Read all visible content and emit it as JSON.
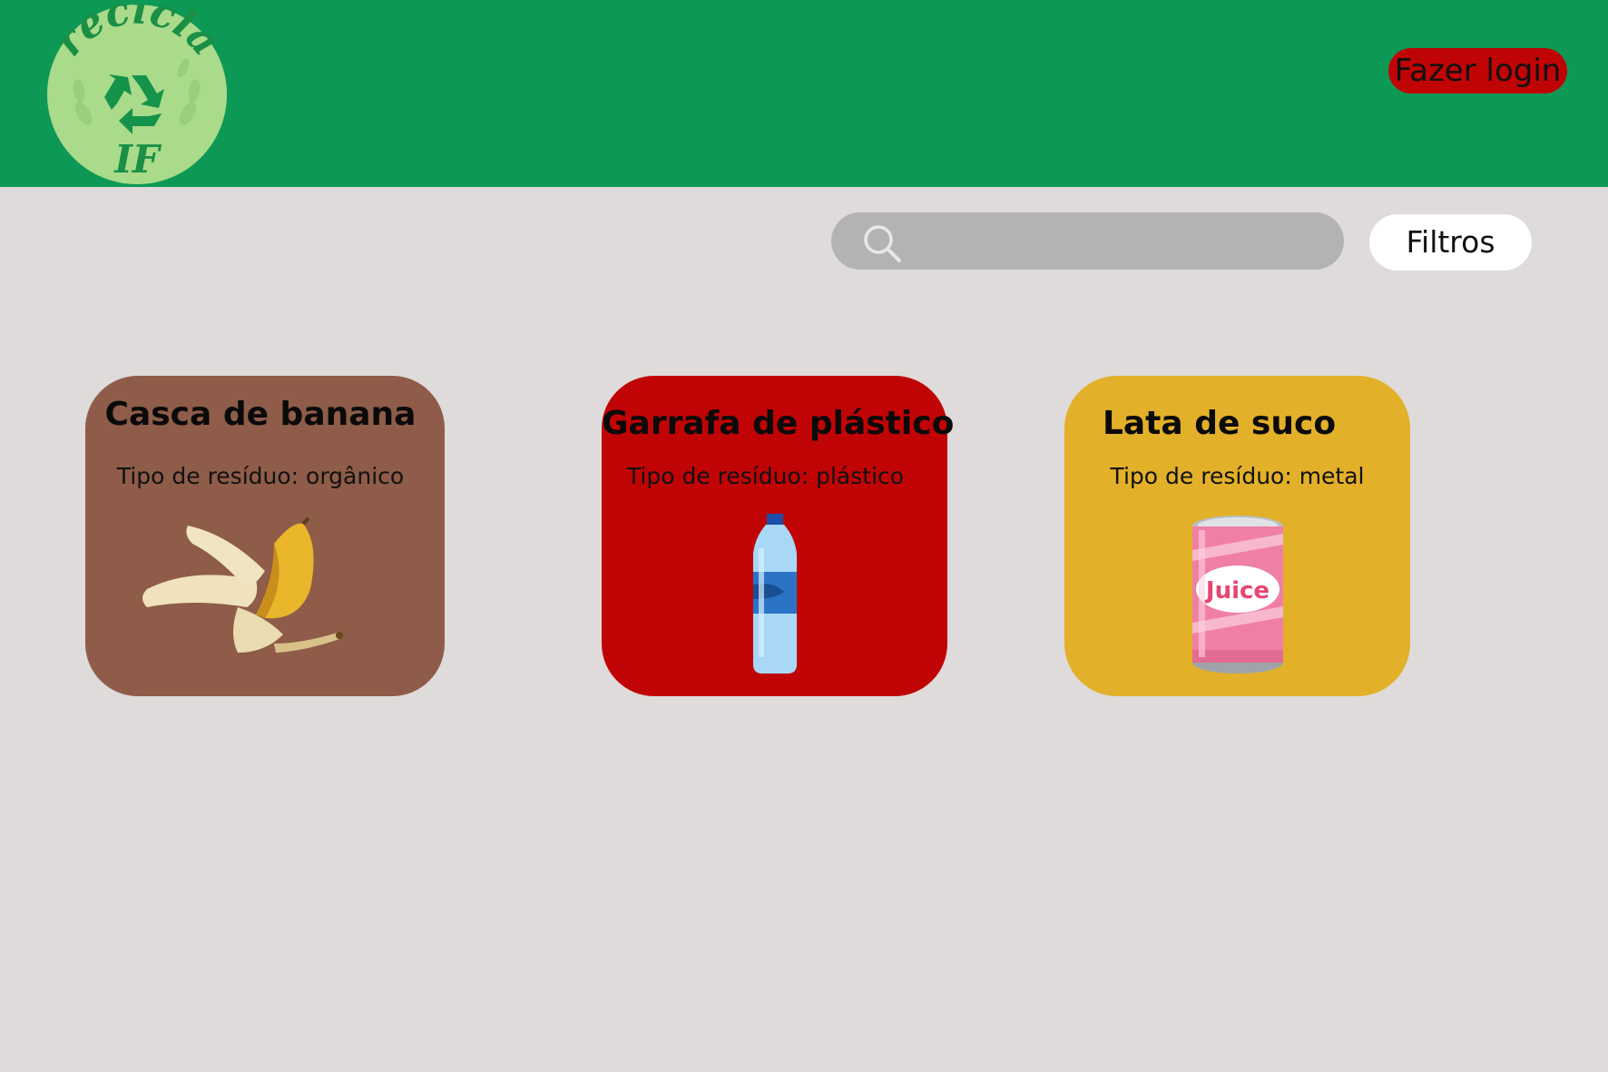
{
  "header": {
    "logo": {
      "text_top": "recicla",
      "text_bottom": "IF",
      "icon": "recycle-icon"
    },
    "login_label": "Fazer login"
  },
  "search": {
    "placeholder": "",
    "icon": "search-icon",
    "filter_label": "Filtros"
  },
  "cards": [
    {
      "title": "Casca de banana",
      "type_text": "Tipo de resíduo: orgânico",
      "color": "#8e5c48",
      "image": "banana-peel"
    },
    {
      "title": "Garrafa de plástico",
      "type_text": "Tipo de resíduo: plástico",
      "color": "#c00406",
      "image": "plastic-bottle"
    },
    {
      "title": "Lata de suco",
      "type_text": "Tipo de resíduo: metal",
      "color": "#e3b02a",
      "image": "juice-can",
      "image_label": "Juice"
    }
  ],
  "colors": {
    "header": "#0e9856",
    "background": "#dfdbdb",
    "login": "#c00406",
    "search": "#b3b3b3"
  }
}
